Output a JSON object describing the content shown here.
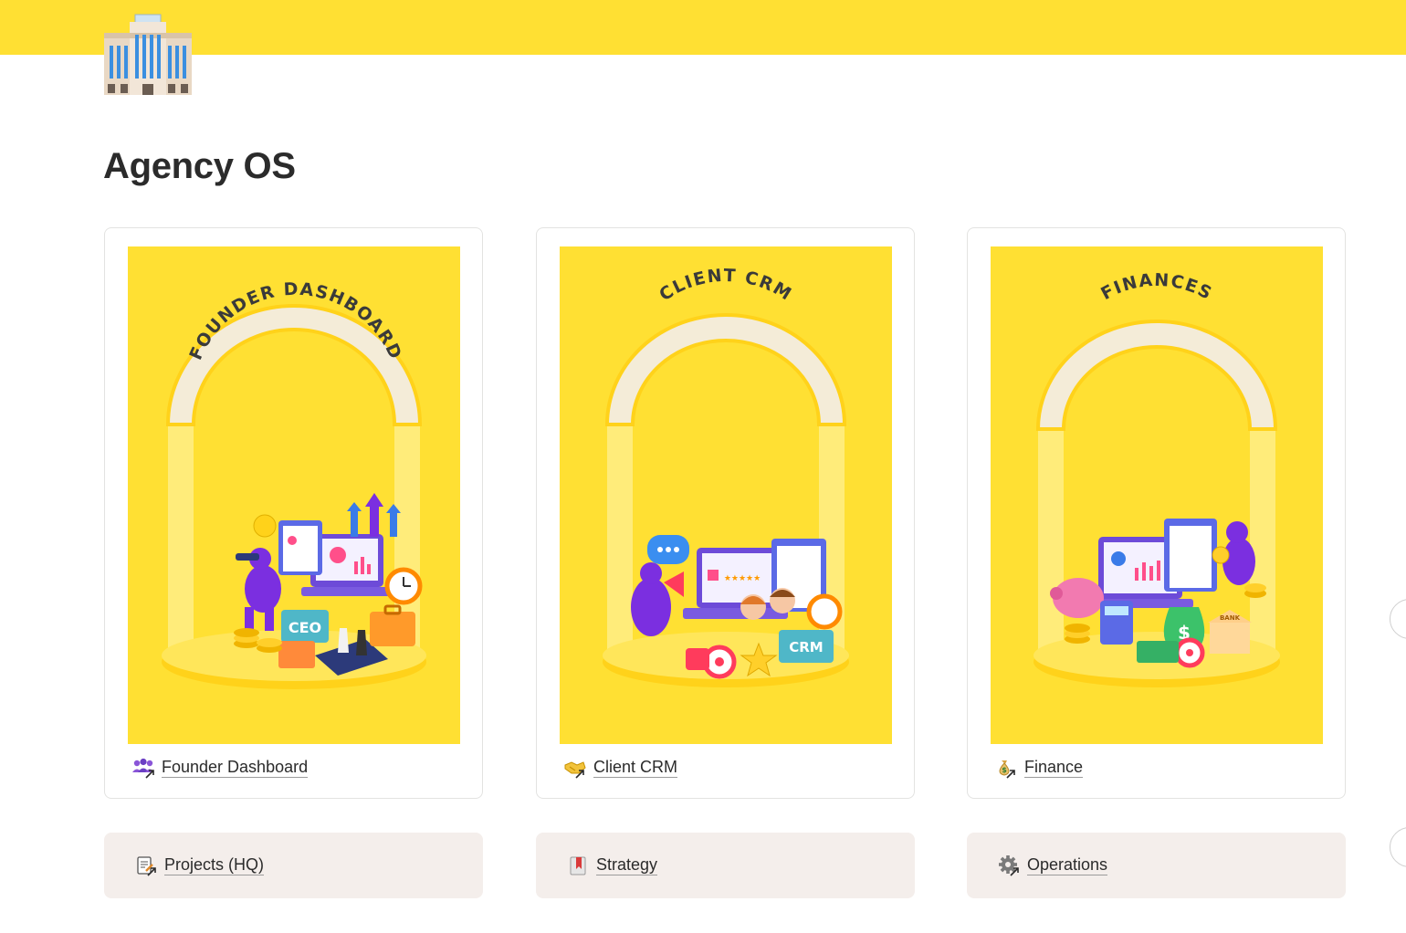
{
  "page": {
    "title": "Agency OS",
    "icon": "office-building-icon",
    "cover_color": "#ffe033"
  },
  "cards": [
    {
      "label": "Founder Dashboard",
      "art_title": "FOUNDER DASHBOARD",
      "icon": "people-arrow-icon"
    },
    {
      "label": "Client CRM",
      "art_title": "CLIENT CRM",
      "icon": "handshake-arrow-icon"
    },
    {
      "label": "Finance",
      "art_title": "FINANCES",
      "icon": "money-bag-arrow-icon"
    }
  ],
  "links": [
    {
      "label": "Projects (HQ)",
      "icon": "clipboard-pen-arrow-icon"
    },
    {
      "label": "Strategy",
      "icon": "bookmark-icon"
    },
    {
      "label": "Operations",
      "icon": "gear-arrow-icon"
    }
  ],
  "art_badges": {
    "ceo": "CEO",
    "crm": "CRM",
    "bank": "BANK",
    "dollar": "$"
  },
  "colors": {
    "accent_yellow": "#ffe033",
    "link_bg": "#f4eeeb",
    "figure_purple": "#7b2fe0"
  }
}
